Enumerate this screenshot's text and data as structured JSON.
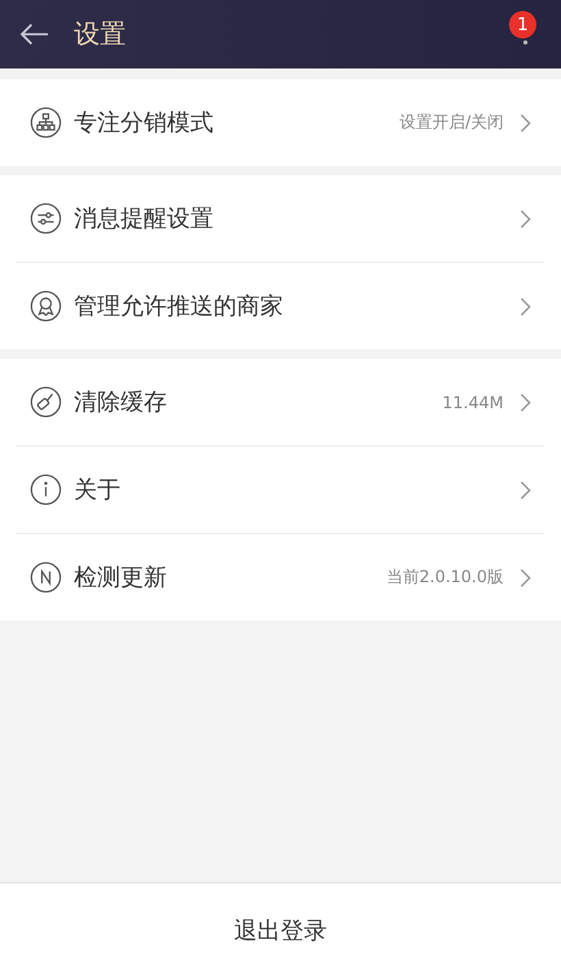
{
  "header": {
    "title": "设置",
    "badge": "1"
  },
  "groups": [
    {
      "rows": [
        {
          "label": "专注分销模式",
          "value": "设置开启/关闭"
        }
      ]
    },
    {
      "rows": [
        {
          "label": "消息提醒设置"
        },
        {
          "label": "管理允许推送的商家"
        }
      ]
    },
    {
      "rows": [
        {
          "label": "清除缓存",
          "value": "11.44M"
        },
        {
          "label": "关于"
        },
        {
          "label": "检测更新",
          "value": "当前2.0.10.0版"
        }
      ]
    }
  ],
  "logout": "退出登录"
}
